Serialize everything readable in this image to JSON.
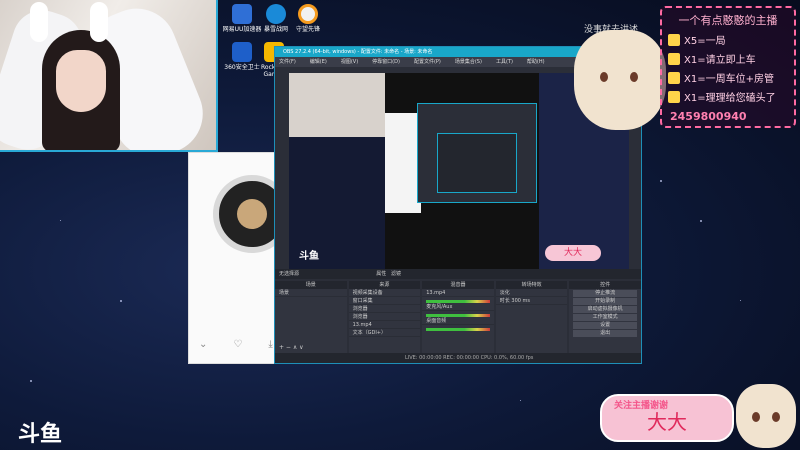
{
  "desktop": {
    "icons": [
      {
        "label": "网易UU加速器",
        "icon": "uu-accelerator-icon",
        "color": "#2f6fd6"
      },
      {
        "label": "暴雪战网",
        "icon": "battlenet-icon",
        "color": "#1a8ad8"
      },
      {
        "label": "守望先锋",
        "icon": "overwatch-icon",
        "color": "#f1f1f1"
      },
      {
        "label": "360安全卫士",
        "icon": "360-icon",
        "color": "#1e5fc9"
      },
      {
        "label": "Rockstar Games",
        "icon": "rockstar-icon",
        "color": "#f5b800"
      }
    ]
  },
  "obs": {
    "title": "OBS 27.2.4 (64-bit, windows) - 配置文件: 未命名 - 场景: 未命名",
    "menu": [
      "文件(F)",
      "编辑(E)",
      "视图(V)",
      "停靠窗口(D)",
      "配置文件(P)",
      "场景集合(S)",
      "工具(T)",
      "帮助(H)"
    ],
    "preview_logo": "斗鱼",
    "preview_name": "大大",
    "scene_bar_left": "无选择源",
    "scene_bar_props": "属性",
    "scene_bar_filters": "滤镜",
    "docks": {
      "scenes": {
        "header": "场景",
        "items": [
          "场景"
        ]
      },
      "sources": {
        "header": "来源",
        "items": [
          "视频采集设备",
          "窗口采集",
          "浏览器",
          "浏览器",
          "13.mp4",
          "文本（GDI+）"
        ]
      },
      "mixer": {
        "header": "混音器",
        "tracks": [
          {
            "name": "13.mp4",
            "db": "0.0 dB"
          },
          {
            "name": "麦克风/Aux",
            "db": "0.0 dB"
          },
          {
            "name": "桌面音频",
            "db": "0.0 dB"
          }
        ]
      },
      "transitions": {
        "header": "转场特效",
        "type": "淡化",
        "duration_label": "时长",
        "duration": "300 ms"
      },
      "controls": {
        "header": "控件",
        "buttons": [
          "停止推流",
          "开始录制",
          "启动虚拟摄像机",
          "工作室模式",
          "设置",
          "退出"
        ]
      }
    },
    "status": "LIVE: 00:00:00   REC: 00:00:00   CPU: 0.0%, 60.00 fps"
  },
  "overlay": {
    "top_text": "没事就去讲述",
    "rules_title": "一个有点憨憨的主播",
    "rules": [
      "X5=一局",
      "X1=请立即上车",
      "X1=一周车位+房管",
      "X1=理理给您磕头了"
    ],
    "qq": "2459800940",
    "name_tag": "关注主播谢谢",
    "name": "大大",
    "platform_logo": "斗鱼"
  },
  "colors": {
    "accent": "#19a7c9",
    "pink": "#f7c2d4",
    "name_red": "#e02a5c"
  }
}
